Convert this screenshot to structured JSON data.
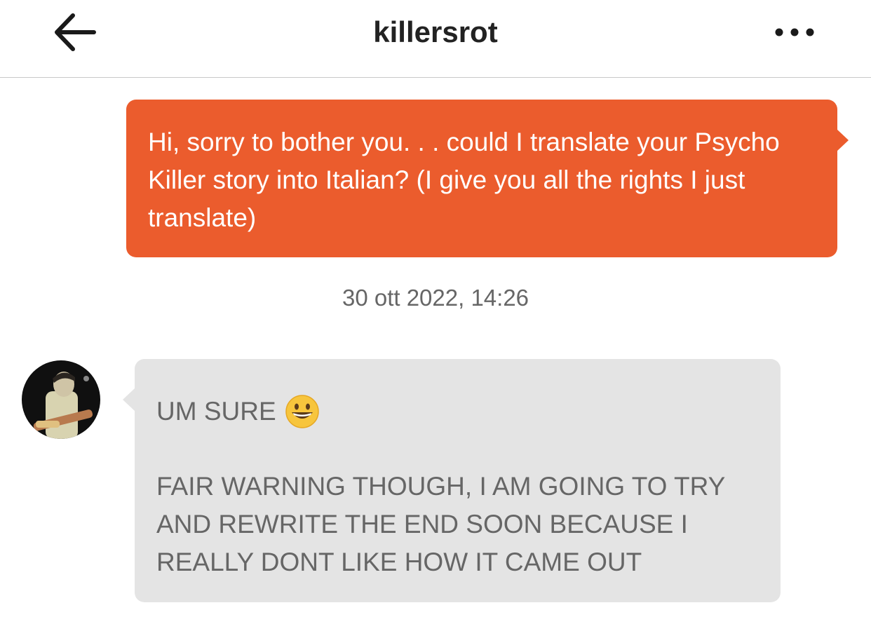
{
  "header": {
    "title": "killersrot",
    "back_icon": "arrow-left-icon",
    "more_icon": "more-horizontal-icon"
  },
  "conversation": {
    "outgoing_message": "Hi, sorry to bother you. . . could I translate your Psycho Killer story into Italian? (I give you all the rights I just translate)",
    "timestamp": "30 ott 2022, 14:26",
    "incoming_message": {
      "line1": "UM SURE",
      "emoji": "grinning-face-emoji",
      "paragraph2": "FAIR WARNING THOUGH, I AM GOING TO TRY AND REWRITE THE END SOON BECAUSE I REALLY DONT LIKE HOW IT CAME OUT"
    }
  },
  "colors": {
    "outgoing_bubble": "#eb5c2d",
    "incoming_bubble": "#e4e4e4",
    "header_text": "#222222",
    "timestamp_text": "#666666"
  }
}
